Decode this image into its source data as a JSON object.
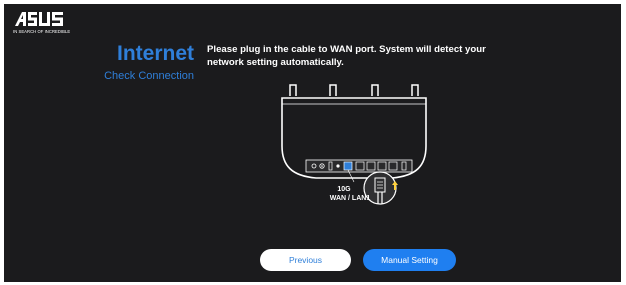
{
  "brand": {
    "tagline": "IN SEARCH OF INCREDIBLE"
  },
  "header": {
    "title": "Internet",
    "subtitle": "Check Connection"
  },
  "main": {
    "instruction": "Please plug in the cable to WAN port. System will detect your network setting automatically.",
    "diagram": {
      "port_speed": "10G",
      "port_name": "WAN / LAN1"
    }
  },
  "footer": {
    "previous_label": "Previous",
    "manual_label": "Manual Setting"
  },
  "colors": {
    "accent": "#2f7fd9",
    "button_primary": "#1f7ff0",
    "background": "#1b1b1d",
    "highlight": "#ffd23f"
  }
}
